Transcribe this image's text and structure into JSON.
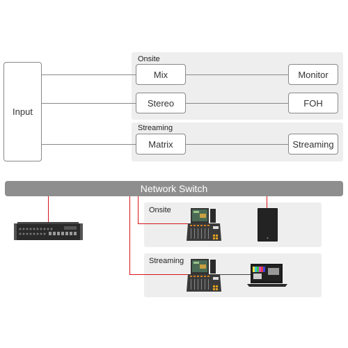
{
  "signal_flow": {
    "input_label": "Input",
    "groups": [
      {
        "label": "Onsite",
        "buses": [
          {
            "source": "Mix",
            "destination": "Monitor"
          },
          {
            "source": "Stereo",
            "destination": "FOH"
          }
        ]
      },
      {
        "label": "Streaming",
        "buses": [
          {
            "source": "Matrix",
            "destination": "Streaming"
          }
        ]
      }
    ]
  },
  "network": {
    "switch_label": "Network Switch",
    "cable_color": "#d7141a",
    "stagebox_icon": "io-rack-device",
    "groups": [
      {
        "label": "Onsite",
        "devices": [
          "mixing-console",
          "speaker"
        ]
      },
      {
        "label": "Streaming",
        "devices": [
          "mixing-console",
          "laptop"
        ]
      }
    ]
  }
}
